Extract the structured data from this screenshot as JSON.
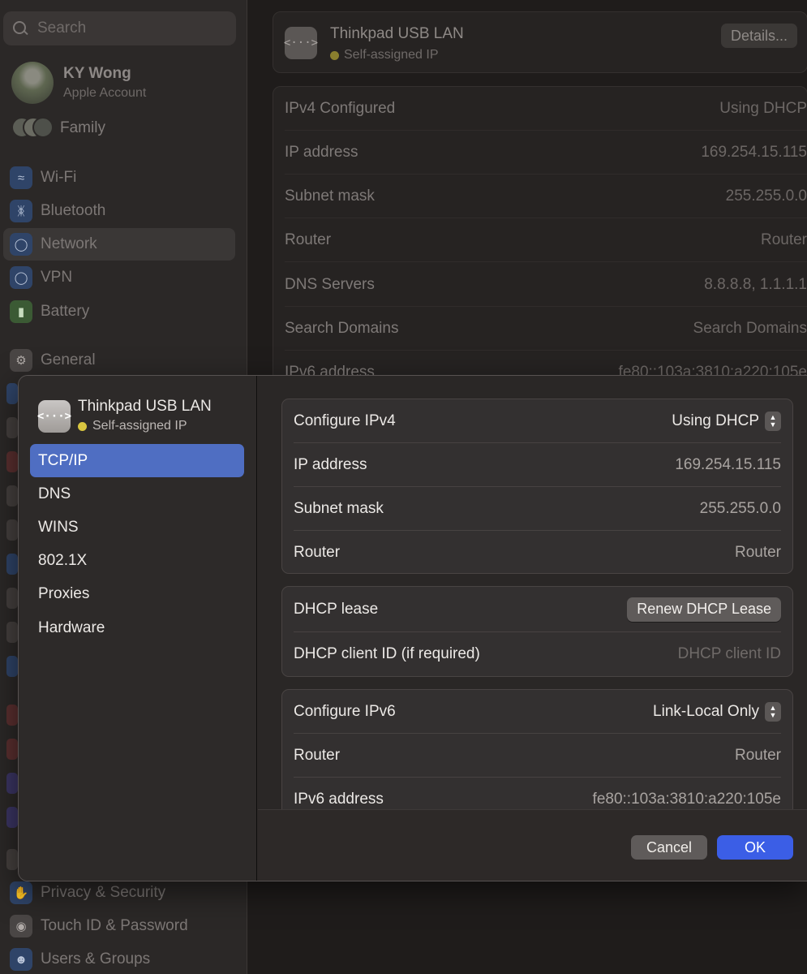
{
  "background": {
    "search": {
      "placeholder": "Search"
    },
    "account": {
      "name": "KY Wong",
      "subtitle": "Apple Account"
    },
    "family_label": "Family",
    "sidebar": {
      "items": [
        {
          "label": "Wi-Fi",
          "icon": "wifi-icon"
        },
        {
          "label": "Bluetooth",
          "icon": "bluetooth-icon"
        },
        {
          "label": "Network",
          "icon": "globe-icon",
          "selected": true
        },
        {
          "label": "VPN",
          "icon": "vpn-globe-icon"
        },
        {
          "label": "Battery",
          "icon": "battery-icon"
        },
        {
          "label": "General",
          "icon": "gear-icon"
        },
        {
          "label": "Privacy & Security",
          "icon": "hand-icon"
        },
        {
          "label": "Touch ID & Password",
          "icon": "fingerprint-icon"
        },
        {
          "label": "Users & Groups",
          "icon": "users-icon"
        }
      ]
    },
    "main": {
      "service_title": "Thinkpad USB LAN",
      "service_status": "Self-assigned IP",
      "details_button": "Details...",
      "rows": [
        {
          "label": "IPv4 Configured",
          "value": "Using DHCP"
        },
        {
          "label": "IP address",
          "value": "169.254.15.115"
        },
        {
          "label": "Subnet mask",
          "value": "255.255.0.0"
        },
        {
          "label": "Router",
          "value": "Router"
        },
        {
          "label": "DNS Servers",
          "value": "8.8.8.8, 1.1.1.1"
        },
        {
          "label": "Search Domains",
          "value": "Search Domains"
        },
        {
          "label": "IPv6 address",
          "value": "fe80::103a:3810:a220:105e"
        }
      ]
    }
  },
  "sheet": {
    "header": {
      "title": "Thinkpad USB LAN",
      "status": "Self-assigned IP",
      "status_color": "#e8d44d"
    },
    "nav": [
      {
        "label": "TCP/IP",
        "active": true
      },
      {
        "label": "DNS"
      },
      {
        "label": "WINS"
      },
      {
        "label": "802.1X"
      },
      {
        "label": "Proxies"
      },
      {
        "label": "Hardware"
      }
    ],
    "ipv4": {
      "configure_label": "Configure IPv4",
      "configure_value": "Using DHCP",
      "ip_label": "IP address",
      "ip_value": "169.254.15.115",
      "subnet_label": "Subnet mask",
      "subnet_value": "255.255.0.0",
      "router_label": "Router",
      "router_value": "Router"
    },
    "dhcp": {
      "lease_label": "DHCP lease",
      "renew_button": "Renew DHCP Lease",
      "client_id_label": "DHCP client ID (if required)",
      "client_id_placeholder": "DHCP client ID"
    },
    "ipv6": {
      "configure_label": "Configure IPv6",
      "configure_value": "Link-Local Only",
      "router_label": "Router",
      "router_value": "Router",
      "address_label": "IPv6 address",
      "address_value": "fe80::103a:3810:a220:105e"
    },
    "footer": {
      "cancel": "Cancel",
      "ok": "OK"
    },
    "colors": {
      "accent": "#3b5ee6",
      "selection": "#4f6ec2"
    }
  }
}
